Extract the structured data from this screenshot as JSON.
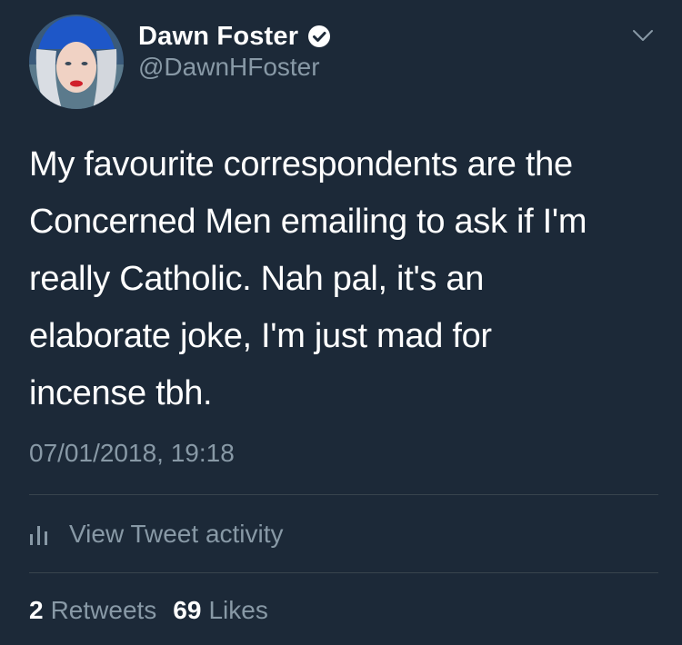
{
  "author": {
    "display_name": "Dawn Foster",
    "handle": "@DawnHFoster",
    "verified_icon": "verified-badge-icon"
  },
  "tweet": {
    "text": "My favourite correspondents are the\nConcerned Men emailing to ask if I'm\nreally Catholic. Nah pal, it's an\nelaborate joke, I'm just mad for\nincense tbh.",
    "timestamp": "07/01/2018, 19:18"
  },
  "activity": {
    "label": "View Tweet activity",
    "icon": "bar-chart-icon"
  },
  "stats": {
    "retweets_count": "2",
    "retweets_label": "Retweets",
    "likes_count": "69",
    "likes_label": "Likes"
  },
  "colors": {
    "background": "#1c2938",
    "primary_text": "#ffffff",
    "secondary_text": "#8899a6",
    "divider": "#38444d"
  }
}
